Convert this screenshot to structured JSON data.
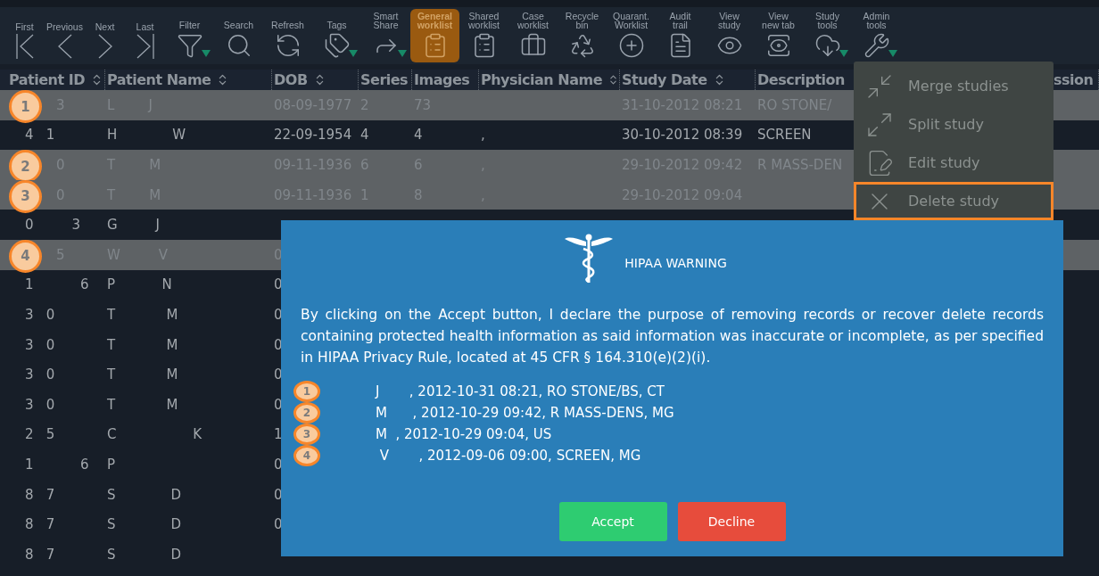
{
  "toolbar": [
    {
      "label": "First",
      "kind": "nav",
      "dropdown": false,
      "selected": false
    },
    {
      "label": "Previous",
      "kind": "nav",
      "dropdown": false,
      "selected": false
    },
    {
      "label": "Next",
      "kind": "nav",
      "dropdown": false,
      "selected": false
    },
    {
      "label": "Last",
      "kind": "nav",
      "dropdown": false,
      "selected": false
    },
    {
      "label": "Filter",
      "kind": "tool",
      "dropdown": true,
      "selected": false
    },
    {
      "label": "Search",
      "kind": "tool",
      "dropdown": false,
      "selected": false
    },
    {
      "label": "Refresh",
      "kind": "tool",
      "dropdown": false,
      "selected": false
    },
    {
      "label": "Tags",
      "kind": "tool",
      "dropdown": true,
      "selected": false
    },
    {
      "label": "Smart\nShare",
      "kind": "tool",
      "dropdown": true,
      "selected": false
    },
    {
      "label": "General\nworklist",
      "kind": "tool",
      "dropdown": false,
      "selected": true
    },
    {
      "label": "Shared\nworklist",
      "kind": "tool",
      "dropdown": false,
      "selected": false
    },
    {
      "label": "Case\nworklist",
      "kind": "tool",
      "dropdown": false,
      "selected": false
    },
    {
      "label": "Recycle\nbin",
      "kind": "tool",
      "dropdown": false,
      "selected": false
    },
    {
      "label": "Quarant.\nWorklist",
      "kind": "tool",
      "dropdown": false,
      "selected": false
    },
    {
      "label": "Audit\ntrail",
      "kind": "tool",
      "dropdown": false,
      "selected": false
    },
    {
      "label": "View\nstudy",
      "kind": "tool",
      "dropdown": false,
      "selected": false
    },
    {
      "label": "View\nnew tab",
      "kind": "tool",
      "dropdown": false,
      "selected": false
    },
    {
      "label": "Study\ntools",
      "kind": "tool",
      "dropdown": true,
      "selected": false
    },
    {
      "label": "Admin\ntools",
      "kind": "tool",
      "dropdown": true,
      "selected": false
    }
  ],
  "table": {
    "columns": [
      {
        "label": "Patient ID",
        "sortable": true
      },
      {
        "label": "Patient Name",
        "sortable": true
      },
      {
        "label": "DOB",
        "sortable": true
      },
      {
        "label": "Series"
      },
      {
        "label": "Images"
      },
      {
        "label": "Physician Name",
        "sortable": true
      },
      {
        "label": "Study Date",
        "sortable": true
      },
      {
        "label": "Description"
      },
      {},
      {
        "label": "ssion"
      }
    ],
    "rows": [
      {
        "selected": true,
        "badge": "1",
        "cells": [
          "3",
          "L        J",
          "08-09-1977",
          "2",
          "73",
          null,
          "31-10-2012 08:21",
          "RO STONE/"
        ]
      },
      {
        "selected": false,
        "cells": [
          "4   1",
          "H             W",
          "22-09-1954",
          "4",
          "4",
          ",",
          "30-10-2012 08:39",
          "SCREEN"
        ]
      },
      {
        "selected": true,
        "badge": "2",
        "cells": [
          "0",
          "T        M",
          "09-11-1936",
          "6",
          "6",
          ",",
          "29-10-2012 09:42",
          "R MASS-DEN"
        ]
      },
      {
        "selected": true,
        "badge": "3",
        "cells": [
          "0",
          "T        M",
          "09-11-1936",
          "1",
          "8",
          ",",
          "29-10-2012 09:04"
        ]
      },
      {
        "selected": false,
        "cells": [
          "0         3",
          "G         J"
        ]
      },
      {
        "selected": true,
        "badge": "4",
        "cells": [
          "5",
          "W         V",
          "0"
        ]
      },
      {
        "selected": false,
        "cells": [
          "1           6",
          "P           N",
          "0"
        ]
      },
      {
        "selected": false,
        "cells": [
          "3   0",
          "T            M",
          "0"
        ]
      },
      {
        "selected": false,
        "cells": [
          "3   0",
          "T            M",
          "0"
        ]
      },
      {
        "selected": false,
        "cells": [
          "3   0",
          "T            M",
          "0"
        ]
      },
      {
        "selected": false,
        "cells": [
          "3   0",
          "T            M",
          "0"
        ]
      },
      {
        "selected": false,
        "cells": [
          "2   5",
          "C                  K",
          "1"
        ]
      },
      {
        "selected": false,
        "cells": [
          "1           6",
          "P",
          "0"
        ]
      },
      {
        "selected": false,
        "cells": [
          "8   7",
          "S             D",
          "0"
        ]
      },
      {
        "selected": false,
        "cells": [
          "8   7",
          "S             D",
          "0"
        ]
      },
      {
        "selected": false,
        "cells": [
          "8   7",
          "S             D"
        ]
      }
    ]
  },
  "menu": [
    {
      "label": "Merge studies",
      "selected": false
    },
    {
      "label": "Split study",
      "selected": false
    },
    {
      "label": "Edit study",
      "selected": false
    },
    {
      "label": "Delete study",
      "selected": true
    }
  ],
  "dialog": {
    "title": "HIPAA WARNING",
    "message": "By clicking on the Accept button, I declare the purpose of removing records or recover delete records containing protected health information as said information was inaccurate or incomplete, as per specified in HIPAA Privacy Rule, located at 45 CFR § 164.310(e)(2)(i).",
    "items": [
      {
        "badge": "1",
        "text": "J       , 2012-10-31 08:21, RO STONE/BS, CT"
      },
      {
        "badge": "2",
        "text": "M      , 2012-10-29 09:42, R MASS-DENS, MG"
      },
      {
        "badge": "3",
        "text": "M  , 2012-10-29 09:04, US"
      },
      {
        "badge": "4",
        "text": " V       , 2012-09-06 09:00, SCREEN, MG"
      }
    ],
    "buttons": [
      {
        "label": "Accept",
        "kind": "accept"
      },
      {
        "label": "Decline",
        "kind": "decline"
      }
    ]
  }
}
